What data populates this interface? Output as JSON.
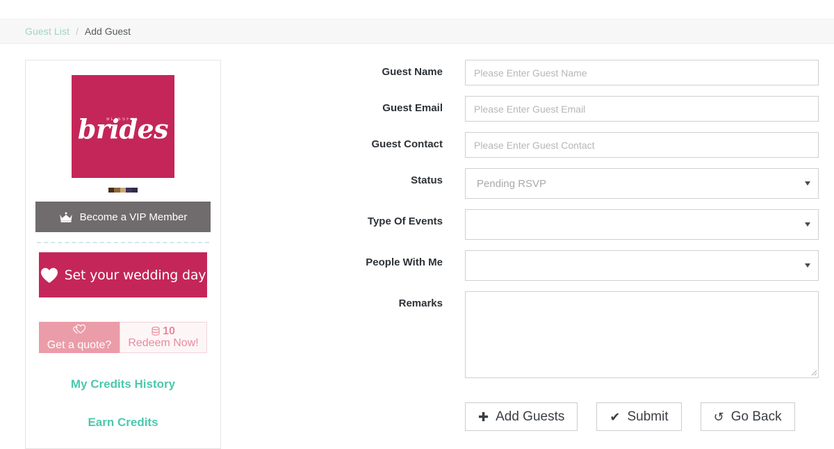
{
  "breadcrumb": {
    "link_label": "Guest List",
    "separator": "/",
    "current_label": "Add Guest",
    "link_color": "#9ed4c6"
  },
  "sidebar": {
    "logo": {
      "kicker": "BLISSFUL",
      "word": "brides",
      "background_color": "#c4265a"
    },
    "swatch_colors": [
      "#4a2e1a",
      "#8a6a3c",
      "#c8a778",
      "#3a3658",
      "#2e2c44"
    ],
    "vip_button": {
      "label": "Become a VIP Member",
      "icon": "crown-icon",
      "background_color": "#706b6d"
    },
    "wedding_banner": {
      "label": "Set your wedding day",
      "icon": "heart-icon",
      "background_color": "#c4265a"
    },
    "quote_promo": {
      "left_label": "Get a quote?",
      "left_icon": "double-heart-icon",
      "credits_count": "10",
      "credits_icon": "coins-icon",
      "redeem_label": "Redeem Now!",
      "left_background_color": "#eb9ca9",
      "right_text_color": "#e98a9c"
    },
    "links": [
      {
        "label": "My Credits History"
      },
      {
        "label": "Earn Credits"
      }
    ],
    "link_color": "#4bc8ad"
  },
  "form": {
    "fields": [
      {
        "label": "Guest Name",
        "type": "text",
        "placeholder": "Please Enter Guest Name",
        "value": ""
      },
      {
        "label": "Guest Email",
        "type": "text",
        "placeholder": "Please Enter Guest Email",
        "value": ""
      },
      {
        "label": "Guest Contact",
        "type": "text",
        "placeholder": "Please Enter Guest Contact",
        "value": ""
      },
      {
        "label": "Status",
        "type": "select",
        "value": "Pending RSVP"
      },
      {
        "label": "Type Of Events",
        "type": "select",
        "value": ""
      },
      {
        "label": "People With Me",
        "type": "select",
        "value": ""
      },
      {
        "label": "Remarks",
        "type": "textarea",
        "value": ""
      }
    ]
  },
  "buttons": [
    {
      "label": "Add Guests",
      "icon": "plus-icon",
      "glyph": "✚"
    },
    {
      "label": "Submit",
      "icon": "check-icon",
      "glyph": "✔"
    },
    {
      "label": "Go Back",
      "icon": "undo-icon",
      "glyph": "↺"
    }
  ]
}
